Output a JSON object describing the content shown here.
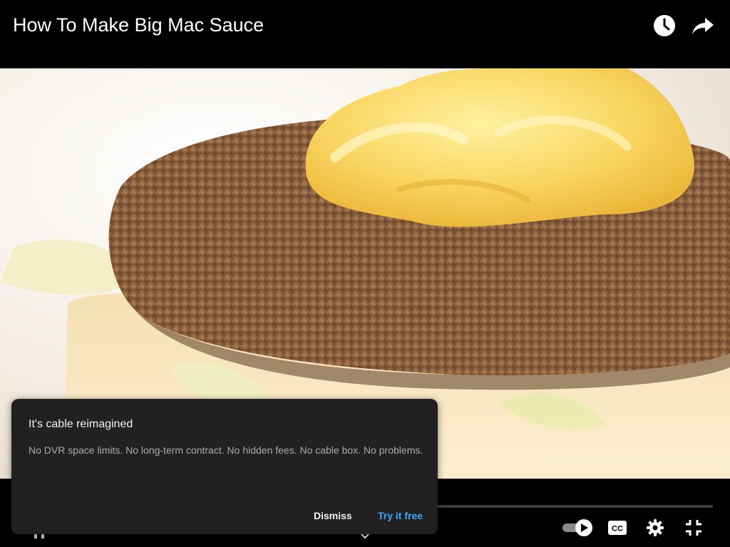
{
  "header": {
    "title": "How To Make Big Mac Sauce",
    "icons": {
      "watch_later": "clock-icon",
      "share": "share-arrow-icon"
    }
  },
  "player": {
    "controls": {
      "autoplay": "autoplay-toggle-icon",
      "captions": "cc-icon",
      "settings": "gear-icon",
      "exit_fullscreen": "exit-fullscreen-icon",
      "expand": "chevron-down-icon"
    }
  },
  "promo": {
    "title": "It's cable reimagined",
    "body": "No DVR space limits. No long-term contract. No hidden fees. No cable box. No problems.",
    "dismiss_label": "Dismiss",
    "cta_label": "Try it free"
  },
  "colors": {
    "background": "#000000",
    "card": "#212121",
    "cta": "#3ea6ff",
    "progress_track": "#3d3d3d"
  }
}
